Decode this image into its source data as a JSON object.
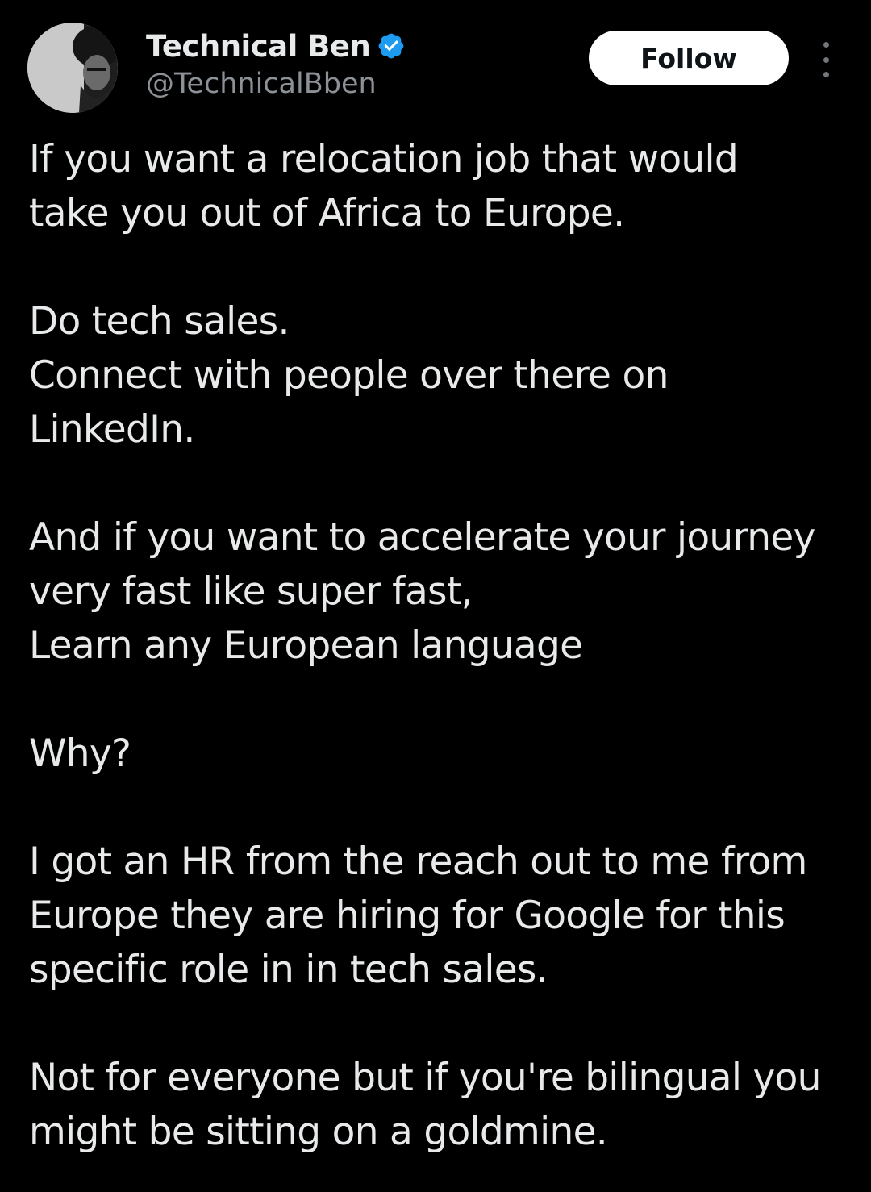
{
  "author": {
    "display_name": "Technical Ben",
    "handle": "@TechnicalBben",
    "verified": true,
    "avatar_icon": "profile-photo-icon",
    "verified_color": "#1d9bf0"
  },
  "actions": {
    "follow_label": "Follow",
    "more_icon": "more-vertical-icon"
  },
  "tweet": {
    "paragraphs": [
      "If you want a relocation job that would\ntake you out of Africa to Europe.",
      "Do tech sales.\nConnect with people over there on\nLinkedIn.",
      "And if you want to accelerate your journey\nvery fast like super fast,\nLearn any European language",
      "Why?",
      "I got an HR from the reach out to me from\nEurope they are hiring for Google for this\nspecific role in in tech sales.",
      "Not for everyone but if you're bilingual you\nmight be sitting on a goldmine."
    ]
  },
  "colors": {
    "background": "#000000",
    "text_primary": "#e7e9ea",
    "text_secondary": "#8b9196",
    "button_bg": "#ffffff",
    "button_text": "#0f1419"
  }
}
